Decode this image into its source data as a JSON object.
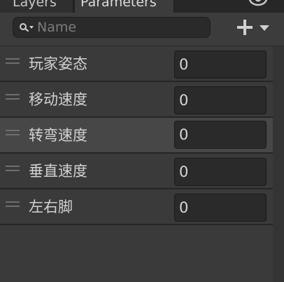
{
  "tabs": [
    {
      "label": "Layers",
      "active": false
    },
    {
      "label": "Parameters",
      "active": true
    }
  ],
  "toolbar": {
    "search_placeholder": "Name",
    "search_value": "",
    "visibility_icon": "eye-icon",
    "add_icon": "plus-icon",
    "dropdown_icon": "caret-down-icon"
  },
  "parameters": [
    {
      "name": "玩家姿态",
      "value": "0"
    },
    {
      "name": "移动速度",
      "value": "0"
    },
    {
      "name": "转弯速度",
      "value": "0",
      "highlighted": true
    },
    {
      "name": "垂直速度",
      "value": "0"
    },
    {
      "name": "左右脚",
      "value": "0"
    }
  ],
  "colors": {
    "panel_bg": "#3a3a3a",
    "row_highlight": "#474747",
    "field_bg": "#2a2a2a",
    "text": "#d2d2d2",
    "placeholder": "#7c7c7c"
  }
}
